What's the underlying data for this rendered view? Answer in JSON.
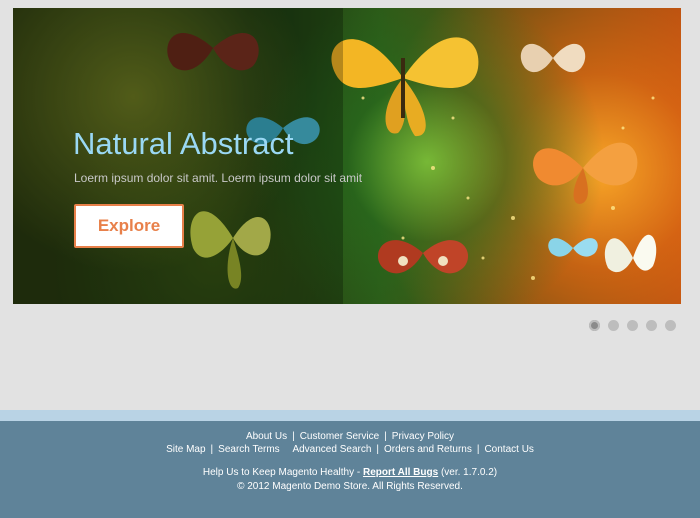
{
  "slide": {
    "title": "Natural Abstract",
    "text": "Loerm ipsum dolor sit amit. Loerm ipsum dolor sit amit",
    "button_label": "Explore"
  },
  "dots": [
    {
      "label": "slide 1",
      "active": true
    },
    {
      "label": "slide 2",
      "active": false
    },
    {
      "label": "slide 3",
      "active": false
    },
    {
      "label": "slide 4",
      "active": false
    },
    {
      "label": "slide 5",
      "active": false
    }
  ],
  "footer": {
    "row1": [
      "About Us",
      "Customer Service",
      "Privacy Policy"
    ],
    "row2": [
      "Site Map",
      "Search Terms",
      "Advanced Search",
      "Orders and Returns",
      "Contact Us"
    ],
    "help_prefix": "Help Us to Keep Magento Healthy - ",
    "help_link": "Report All Bugs",
    "help_version": " (ver. 1.7.0.2)",
    "copyright": "© 2012 Magento Demo Store. All Rights Reserved."
  },
  "colors": {
    "footer_bg": "#5f8399",
    "footer_stripe": "#b9d3e5",
    "title": "#9ad8f4",
    "button_accent": "#e8804a",
    "page_bg": "#e2e2e2"
  }
}
